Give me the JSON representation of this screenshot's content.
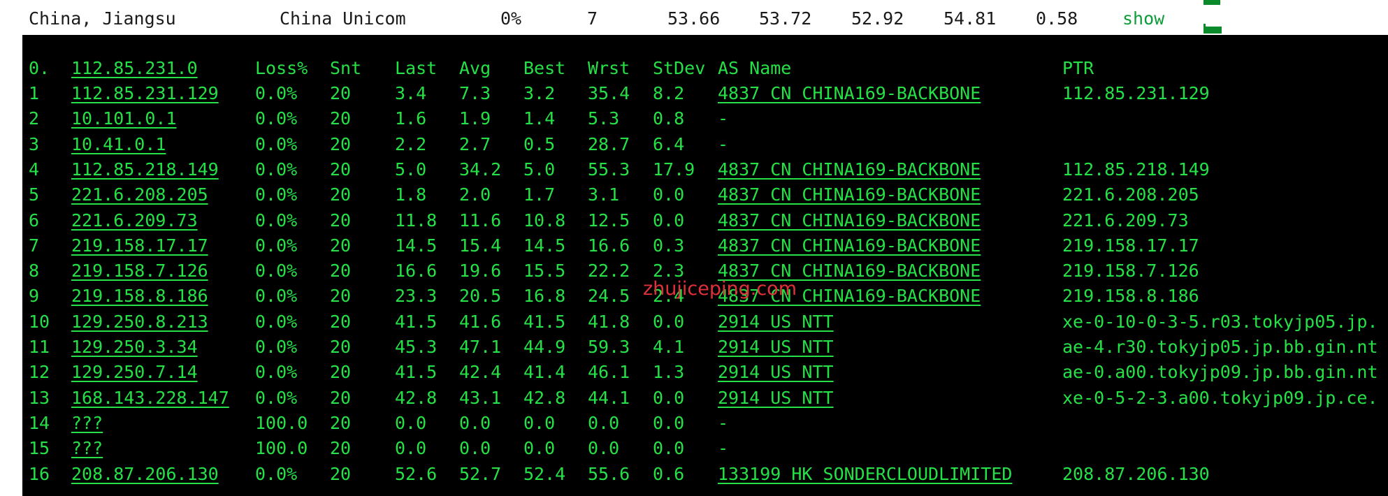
{
  "summary": {
    "location": "China, Jiangsu",
    "isp": "China Unicom",
    "loss": "0%",
    "hops": "7",
    "v1": "53.66",
    "v2": "53.72",
    "v3": "52.92",
    "v4": "54.81",
    "v5": "0.58",
    "link": "show"
  },
  "header": {
    "hop": "0.",
    "host": "112.85.231.0",
    "loss": "Loss%",
    "snt": "Snt",
    "last": "Last",
    "avg": "Avg",
    "best": "Best",
    "wrst": "Wrst",
    "stdev": "StDev",
    "as": "AS Name",
    "ptr": "PTR"
  },
  "hops": [
    {
      "hop": "1",
      "host": "112.85.231.129",
      "loss": "0.0%",
      "snt": "20",
      "last": "3.4",
      "avg": "7.3",
      "best": "3.2",
      "wrst": "35.4",
      "stdev": "8.2",
      "as": "4837  CN CHINA169-BACKBONE",
      "ptr": "112.85.231.129"
    },
    {
      "hop": "2",
      "host": "10.101.0.1",
      "loss": "0.0%",
      "snt": "20",
      "last": "1.6",
      "avg": "1.9",
      "best": "1.4",
      "wrst": "5.3",
      "stdev": "0.8",
      "as": "-",
      "ptr": ""
    },
    {
      "hop": "3",
      "host": "10.41.0.1",
      "loss": "0.0%",
      "snt": "20",
      "last": "2.2",
      "avg": "2.7",
      "best": "0.5",
      "wrst": "28.7",
      "stdev": "6.4",
      "as": "-",
      "ptr": ""
    },
    {
      "hop": "4",
      "host": "112.85.218.149",
      "loss": "0.0%",
      "snt": "20",
      "last": "5.0",
      "avg": "34.2",
      "best": "5.0",
      "wrst": "55.3",
      "stdev": "17.9",
      "as": "4837  CN CHINA169-BACKBONE",
      "ptr": "112.85.218.149"
    },
    {
      "hop": "5",
      "host": "221.6.208.205",
      "loss": "0.0%",
      "snt": "20",
      "last": "1.8",
      "avg": "2.0",
      "best": "1.7",
      "wrst": "3.1",
      "stdev": "0.0",
      "as": "4837  CN CHINA169-BACKBONE",
      "ptr": "221.6.208.205"
    },
    {
      "hop": "6",
      "host": "221.6.209.73",
      "loss": "0.0%",
      "snt": "20",
      "last": "11.8",
      "avg": "11.6",
      "best": "10.8",
      "wrst": "12.5",
      "stdev": "0.0",
      "as": "4837  CN CHINA169-BACKBONE",
      "ptr": "221.6.209.73"
    },
    {
      "hop": "7",
      "host": "219.158.17.17",
      "loss": "0.0%",
      "snt": "20",
      "last": "14.5",
      "avg": "15.4",
      "best": "14.5",
      "wrst": "16.6",
      "stdev": "0.3",
      "as": "4837  CN CHINA169-BACKBONE",
      "ptr": "219.158.17.17"
    },
    {
      "hop": "8",
      "host": "219.158.7.126",
      "loss": "0.0%",
      "snt": "20",
      "last": "16.6",
      "avg": "19.6",
      "best": "15.5",
      "wrst": "22.2",
      "stdev": "2.3",
      "as": "4837  CN CHINA169-BACKBONE",
      "ptr": "219.158.7.126"
    },
    {
      "hop": "9",
      "host": "219.158.8.186",
      "loss": "0.0%",
      "snt": "20",
      "last": "23.3",
      "avg": "20.5",
      "best": "16.8",
      "wrst": "24.5",
      "stdev": "2.4",
      "as": "4837  CN CHINA169-BACKBONE",
      "ptr": "219.158.8.186"
    },
    {
      "hop": "10",
      "host": "129.250.8.213",
      "loss": "0.0%",
      "snt": "20",
      "last": "41.5",
      "avg": "41.6",
      "best": "41.5",
      "wrst": "41.8",
      "stdev": "0.0",
      "as": "2914  US NTT",
      "ptr": "xe-0-10-0-3-5.r03.tokyjp05.jp."
    },
    {
      "hop": "11",
      "host": "129.250.3.34",
      "loss": "0.0%",
      "snt": "20",
      "last": "45.3",
      "avg": "47.1",
      "best": "44.9",
      "wrst": "59.3",
      "stdev": "4.1",
      "as": "2914  US NTT",
      "ptr": "ae-4.r30.tokyjp05.jp.bb.gin.nt"
    },
    {
      "hop": "12",
      "host": "129.250.7.14",
      "loss": "0.0%",
      "snt": "20",
      "last": "41.5",
      "avg": "42.4",
      "best": "41.4",
      "wrst": "46.1",
      "stdev": "1.3",
      "as": "2914  US NTT",
      "ptr": "ae-0.a00.tokyjp09.jp.bb.gin.nt"
    },
    {
      "hop": "13",
      "host": "168.143.228.147",
      "loss": "0.0%",
      "snt": "20",
      "last": "42.8",
      "avg": "43.1",
      "best": "42.8",
      "wrst": "44.1",
      "stdev": "0.0",
      "as": "2914  US NTT",
      "ptr": "xe-0-5-2-3.a00.tokyjp09.jp.ce."
    },
    {
      "hop": "14",
      "host": "???",
      "loss": "100.0",
      "snt": "20",
      "last": "0.0",
      "avg": "0.0",
      "best": "0.0",
      "wrst": "0.0",
      "stdev": "0.0",
      "as": "-",
      "ptr": ""
    },
    {
      "hop": "15",
      "host": "???",
      "loss": "100.0",
      "snt": "20",
      "last": "0.0",
      "avg": "0.0",
      "best": "0.0",
      "wrst": "0.0",
      "stdev": "0.0",
      "as": "-",
      "ptr": ""
    },
    {
      "hop": "16",
      "host": "208.87.206.130",
      "loss": "0.0%",
      "snt": "20",
      "last": "52.6",
      "avg": "52.7",
      "best": "52.4",
      "wrst": "55.6",
      "stdev": "0.6",
      "as": "133199 HK SONDERCLOUDLIMITED",
      "ptr": "208.87.206.130"
    }
  ],
  "watermark": "zhujiceping.com"
}
